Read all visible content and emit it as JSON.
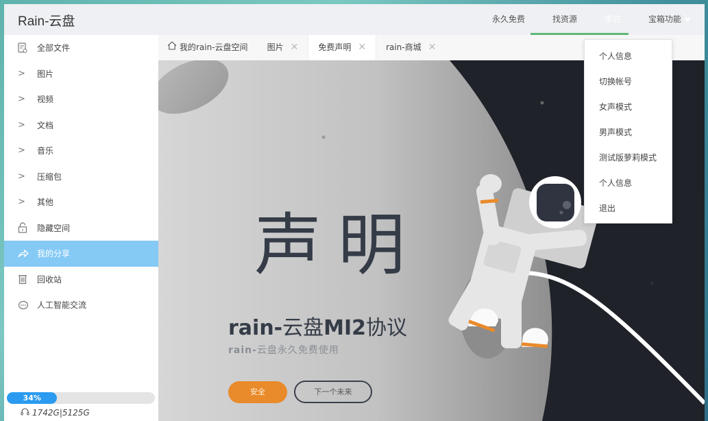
{
  "header": {
    "brand": "Rain-云盘",
    "nav": [
      {
        "label": "永久免费"
      },
      {
        "label": "找资源"
      },
      {
        "label": "李白"
      },
      {
        "label": "宝箱功能"
      }
    ]
  },
  "sidebar": {
    "items": [
      {
        "label": "全部文件",
        "icon": "file-icon"
      },
      {
        "label": "图片",
        "icon": "chevron-right-icon"
      },
      {
        "label": "视频",
        "icon": "chevron-right-icon"
      },
      {
        "label": "文档",
        "icon": "chevron-right-icon"
      },
      {
        "label": "音乐",
        "icon": "chevron-right-icon"
      },
      {
        "label": "压缩包",
        "icon": "chevron-right-icon"
      },
      {
        "label": "其他",
        "icon": "chevron-right-icon"
      },
      {
        "label": "隐藏空间",
        "icon": "lock-icon"
      },
      {
        "label": "我的分享",
        "icon": "share-icon",
        "active": true
      },
      {
        "label": "回收站",
        "icon": "trash-icon"
      },
      {
        "label": "人工智能交流",
        "icon": "chat-icon"
      }
    ],
    "storage": {
      "percent_label": "34%",
      "percent": 34,
      "quota": "1742G|5125G"
    }
  },
  "tabs": [
    {
      "label": "我的rain-云盘空间",
      "icon": "home-icon"
    },
    {
      "label": "图片",
      "closable": true
    },
    {
      "label": "免费声明",
      "closable": true,
      "active": true
    },
    {
      "label": "rain-商城",
      "closable": true
    }
  ],
  "tab_close_glyph": "✕",
  "content": {
    "title": "声明",
    "subtitle_latin": "rain-",
    "subtitle_mid": "云盘",
    "subtitle_model": "MI2",
    "subtitle_end": "协议",
    "tagline_latin": "rain-",
    "tagline": "云盘永久免费使用",
    "primary_button": "安全",
    "secondary_button": "下一个未来"
  },
  "dropdown": {
    "items": [
      {
        "label": "个人信息"
      },
      {
        "label": "切换帐号"
      },
      {
        "label": "女声模式"
      },
      {
        "label": "男声模式"
      },
      {
        "label": "测试版萝莉模式"
      },
      {
        "label": "个人信息"
      },
      {
        "label": "退出"
      }
    ]
  },
  "colors": {
    "accent_green": "#5fb878",
    "active_sidebar": "#85c9f5",
    "progress": "#2a9bf0",
    "orange": "#e98a2b",
    "space_dark": "#1f2229"
  }
}
